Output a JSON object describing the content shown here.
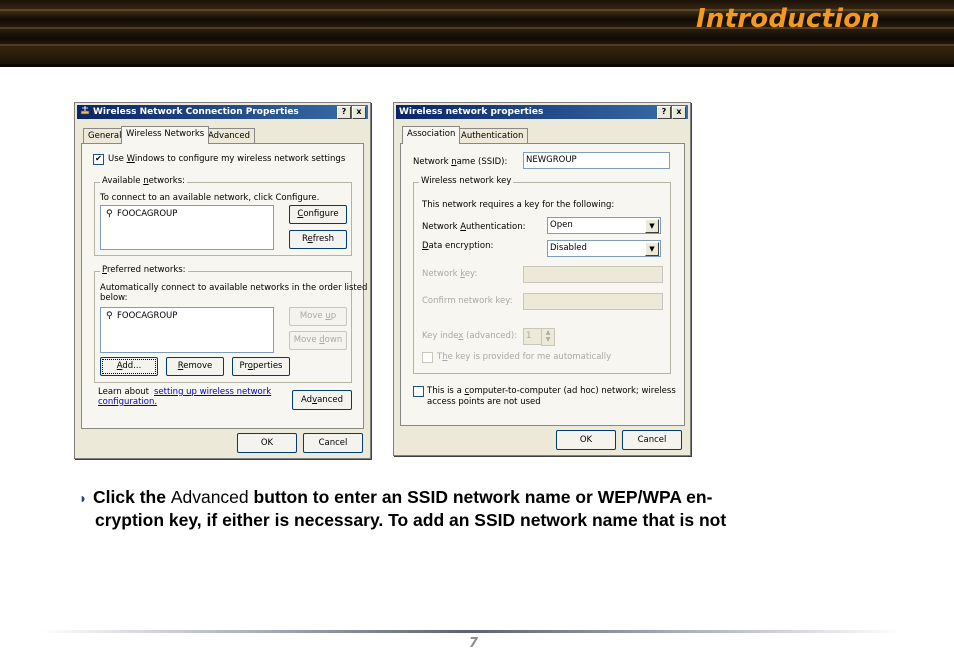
{
  "header": {
    "title": "Introduction"
  },
  "dialog1": {
    "title": "Wireless Network Connection Properties",
    "help_btn": "?",
    "close_btn": "x",
    "tabs": [
      "General",
      "Wireless Networks",
      "Advanced"
    ],
    "use_windows": {
      "pre": "Use ",
      "acc": "W",
      "post": "indows to configure my wireless network settings",
      "checked": "✔"
    },
    "available": {
      "label_pre": "Available ",
      "label_acc": "n",
      "label_post": "etworks:",
      "desc": "To connect to an available network, click Configure.",
      "items": [
        "FOOCAGROUP"
      ],
      "configure_acc": "C",
      "configure_rest": "onfigure",
      "refresh_pre": "R",
      "refresh_acc": "e",
      "refresh_rest": "fresh"
    },
    "preferred": {
      "label_acc": "P",
      "label_post": "referred networks:",
      "desc1": "Automatically connect to available networks in the order listed",
      "desc2": "below:",
      "items": [
        "FOOCAGROUP"
      ],
      "move_up_pre": "Move ",
      "move_up_acc": "u",
      "move_up_post": "p",
      "move_down_pre": "Move ",
      "move_down_acc": "d",
      "move_down_post": "own",
      "add_acc": "A",
      "add_rest": "dd...",
      "remove_acc": "R",
      "remove_rest": "emove",
      "properties_pre": "Pr",
      "properties_acc": "o",
      "properties_post": "perties"
    },
    "learn": {
      "pre": "Learn about ",
      "link1": "setting up wireless network",
      "link2": "configuration."
    },
    "advanced_pre": "Ad",
    "advanced_acc": "v",
    "advanced_post": "anced",
    "ok": "OK",
    "cancel": "Cancel"
  },
  "dialog2": {
    "title": "Wireless network properties",
    "help_btn": "?",
    "close_btn": "x",
    "tabs": [
      "Association",
      "Authentication"
    ],
    "ssid_label_pre": "Network ",
    "ssid_label_acc": "n",
    "ssid_label_post": "ame (SSID):",
    "ssid_value": "NEWGROUP",
    "group_label": "Wireless network key",
    "group_desc": "This network requires a key for the following:",
    "auth_label_pre": "Network ",
    "auth_label_acc": "A",
    "auth_label_post": "uthentication:",
    "auth_value": "Open",
    "enc_label_acc": "D",
    "enc_label_post": "ata encryption:",
    "enc_value": "Disabled",
    "netkey_label_pre": "Network ",
    "netkey_label_acc": "k",
    "netkey_label_post": "ey:",
    "confirm_label": "Confirm network key:",
    "keyindex_label_pre": "Key inde",
    "keyindex_label_acc": "x",
    "keyindex_label_post": " (advanced):",
    "keyindex_value": "1",
    "auto_key_pre": "T",
    "auto_key_acc": "h",
    "auto_key_post": "e key is provided for me automatically",
    "adhoc_line1_pre": "This is a ",
    "adhoc_line1_acc": "c",
    "adhoc_line1_post": "omputer-to-computer (ad hoc) network; wireless",
    "adhoc_line2": "access points are not used",
    "ok": "OK",
    "cancel": "Cancel"
  },
  "body": {
    "bullet_pre": "Click the ",
    "bullet_plain": "Advanced",
    "bullet_post": " button to enter an SSID network name or WEP/WPA en-",
    "bullet_line2": "cryption key, if either is necessary.  To add an SSID network name that is not"
  },
  "footer": {
    "page": "7"
  },
  "colors": {
    "title_orange": "#f39a1e",
    "bullet_blue": "#2a3e8a",
    "xp_blue": "#0a246a"
  }
}
